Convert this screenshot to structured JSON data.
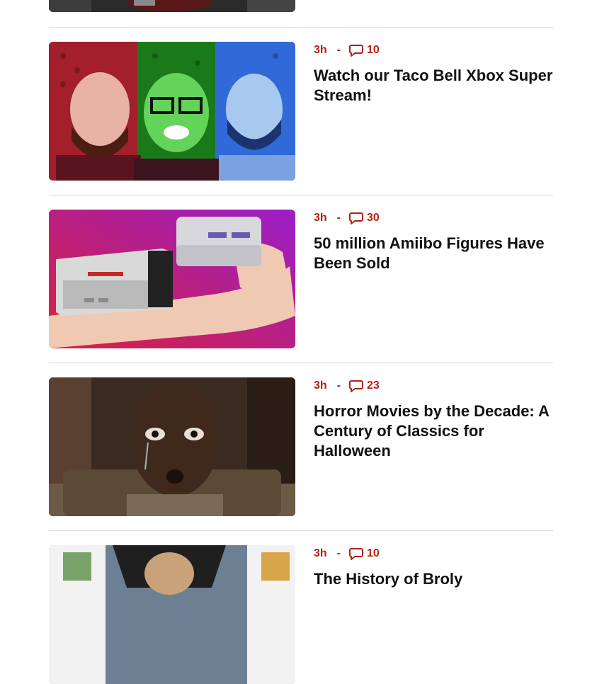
{
  "feed": {
    "articles": [
      {
        "age": "3h",
        "separator": "-",
        "comments": "10",
        "title": "Watch our Taco Bell Xbox Super Stream!",
        "thumbnail_icon": "three-hosts-thumbnail",
        "thumbnail_colors": [
          "#a31f2b",
          "#2fbf2a",
          "#2f6ad8"
        ]
      },
      {
        "age": "3h",
        "separator": "-",
        "comments": "30",
        "title": "50 million Amiibo Figures Have Been Sold",
        "thumbnail_icon": "retro-consoles-thumbnail",
        "thumbnail_colors": [
          "#d8213c",
          "#9a1ec8"
        ]
      },
      {
        "age": "3h",
        "separator": "-",
        "comments": "23",
        "title": "Horror Movies by the Decade: A Century of Classics for Halloween",
        "thumbnail_icon": "crying-man-thumbnail",
        "thumbnail_colors": [
          "#3a2a20",
          "#6b4a32"
        ]
      },
      {
        "age": "3h",
        "separator": "-",
        "comments": "10",
        "title": "The History of Broly",
        "thumbnail_icon": "anime-fighters-thumbnail",
        "thumbnail_colors": [
          "#6d7f93",
          "#f2f2f2"
        ]
      }
    ]
  },
  "theme": {
    "accent": "#b32217",
    "headline": "#111111",
    "divider": "#d9d9d9"
  }
}
